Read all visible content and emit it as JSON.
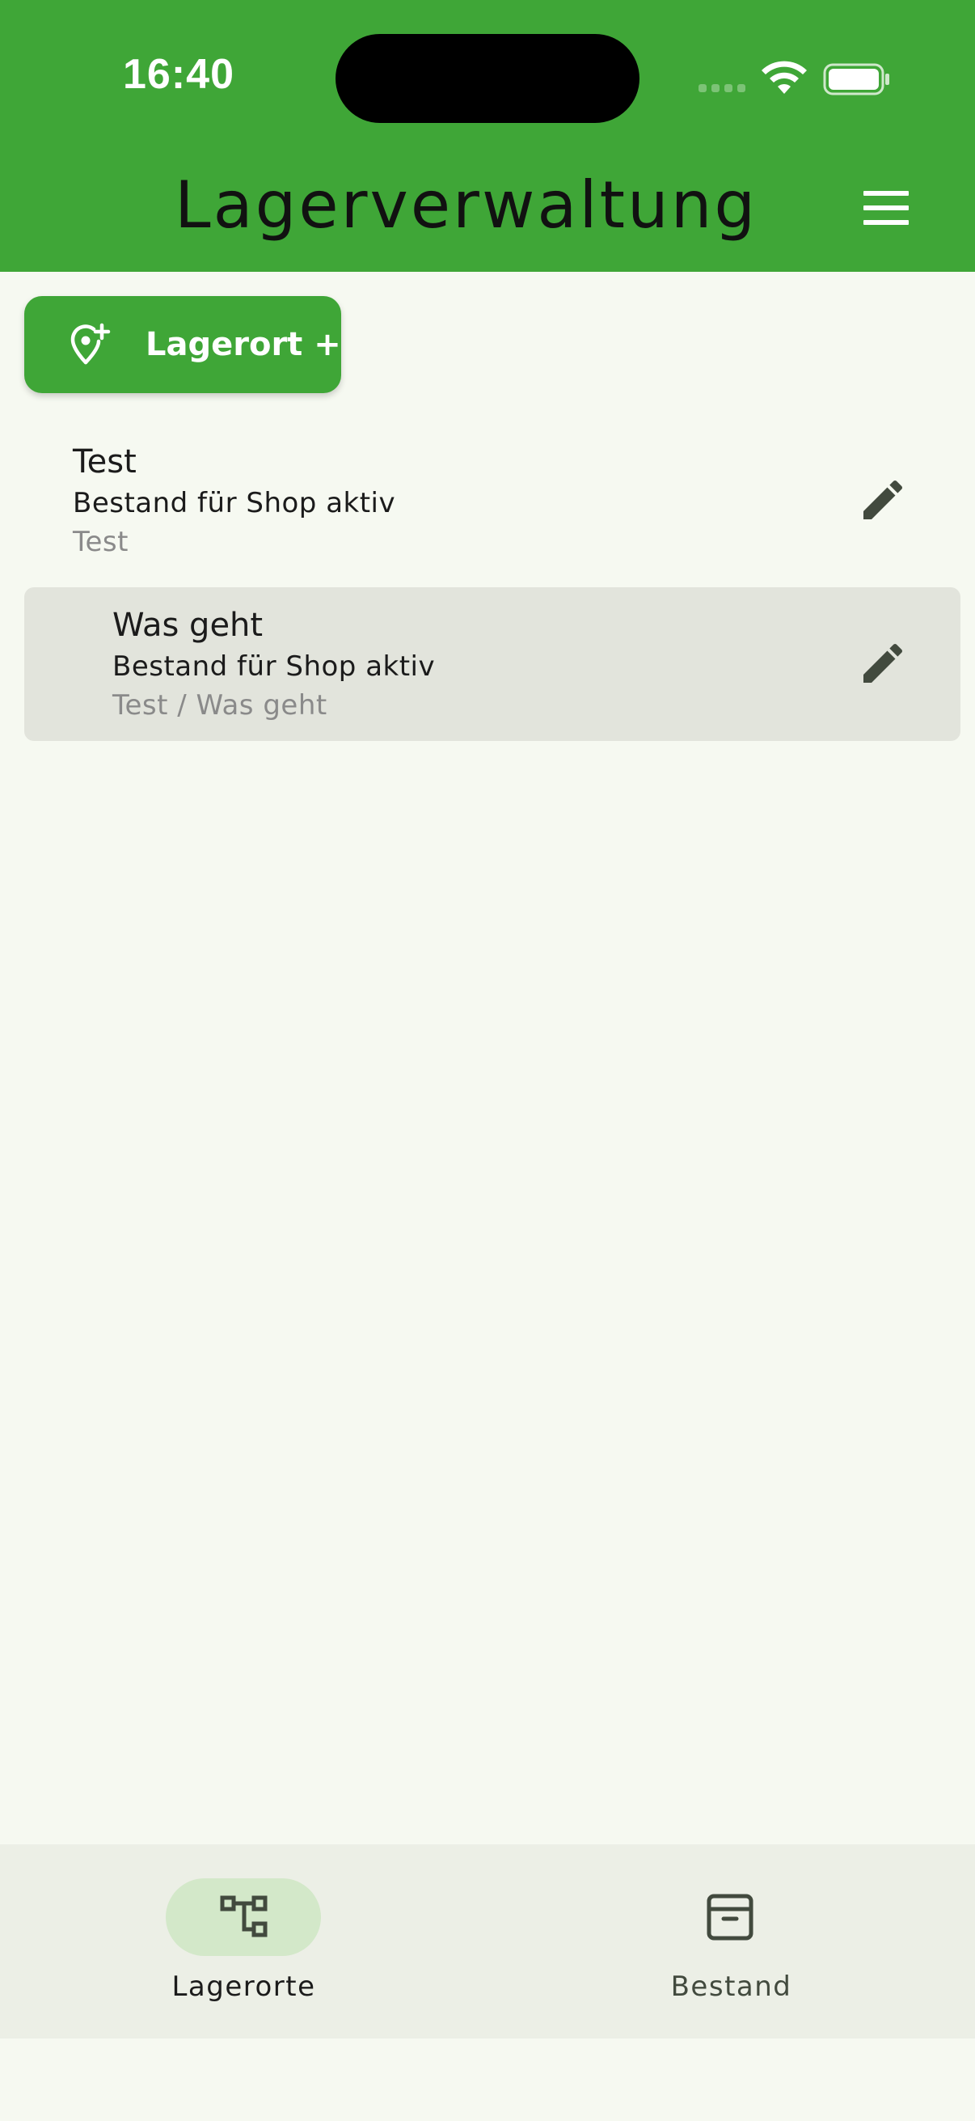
{
  "status_bar": {
    "time": "16:40"
  },
  "app_bar": {
    "title": "Lagerverwaltung",
    "menu_icon": "menu-icon"
  },
  "add_button": {
    "label": "Lagerort +",
    "icon": "add-location-icon"
  },
  "locations": [
    {
      "title": "Test",
      "status": "Bestand für Shop aktiv",
      "path": "Test",
      "selected": false
    },
    {
      "title": "Was geht",
      "status": "Bestand für Shop aktiv",
      "path": "Test / Was geht",
      "selected": true
    }
  ],
  "bottom_nav": {
    "items": [
      {
        "label": "Lagerorte",
        "icon": "hierarchy-icon",
        "active": true
      },
      {
        "label": "Bestand",
        "icon": "archive-box-icon",
        "active": false
      }
    ]
  },
  "colors": {
    "primary": "#3fa637",
    "background": "#f6f9f1",
    "selected_row": "#e2e4dc",
    "nav_background": "#ecefe6",
    "nav_active_pill": "#d3e8c9",
    "icon_dark": "#424a3e"
  }
}
